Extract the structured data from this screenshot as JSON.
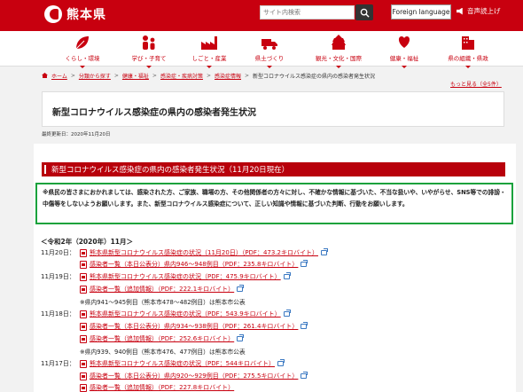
{
  "header": {
    "logo_text": "熊本県",
    "search_placeholder": "サイト内検索",
    "language_button": "Foreign language",
    "voice_button": "音声読上げ"
  },
  "nav": {
    "items": [
      {
        "label": "くらし・環境",
        "icon": "leaf-icon"
      },
      {
        "label": "学び・子育て",
        "icon": "family-icon"
      },
      {
        "label": "しごと・産業",
        "icon": "factory-icon"
      },
      {
        "label": "県土づくり",
        "icon": "truck-icon"
      },
      {
        "label": "観光・文化・国際",
        "icon": "castle-icon"
      },
      {
        "label": "健康・福祉",
        "icon": "heart-hands-icon"
      },
      {
        "label": "県の組織・県政",
        "icon": "building-icon"
      }
    ]
  },
  "breadcrumb": {
    "home": "ホーム",
    "items": [
      "分類から探す",
      "健康・福祉",
      "感染症・疾病対策",
      "感染症情報"
    ],
    "current": "新型コロナウイルス感染症の県内の感染者発生状況"
  },
  "more_link": "もっと見る（全5件）",
  "page_title": "新型コロナウイルス感染症の県内の感染者発生状況",
  "updated": "最終更新日：2020年11月20日",
  "section_header": "新型コロナウイルス感染症の県内の感染者発生状況（11月20日現在）",
  "notice": "※県民の皆さまにおかれましては、感染された方、ご家族、職場の方、その他関係者の方々に対し、不確かな情報に基づいた、不当な扱いや、いやがらせ、SNS等での誹謗・中傷等をしないようお願いします。また、新型コロナウイルス感染症について、正しい知識や情報に基づいた判断、行動をお願いします。",
  "period": "＜令和2年（2020年）11月＞",
  "entries": [
    {
      "date": "11月20日：",
      "link": "熊本県新型コロナウイルス感染症の状況（11月20日）（PDF：473.2キロバイト）"
    },
    {
      "date": "",
      "link": "感染者一覧（本日公表分）県内946～948例目（PDF：235.8キロバイト）"
    },
    {
      "date": "11月19日：",
      "link": "熊本県新型コロナウイルス感染症の状況（PDF：475.9キロバイト）"
    },
    {
      "date": "",
      "link": "感染者一覧（追加情報）（PDF：222.1キロバイト）"
    },
    {
      "note": "※県内941～945例目（熊本市478～482例目）は熊本市公表"
    },
    {
      "date": "11月18日：",
      "link": "熊本県新型コロナウイルス感染症の状況（PDF：543.9キロバイト）"
    },
    {
      "date": "",
      "link": "感染者一覧（本日公表分）県内934～938例目（PDF：261.4キロバイト）"
    },
    {
      "date": "",
      "link": "感染者一覧（追加情報）（PDF：252.6キロバイト）"
    },
    {
      "note": "※県内939、940例目（熊本市476、477例目）は熊本市公表"
    },
    {
      "date": "11月17日：",
      "link": "熊本県新型コロナウイルス感染症の状況（PDF：544キロバイト）"
    },
    {
      "date": "",
      "link": "感染者一覧（本日公表分）県内920～929例目（PDF：275.5キロバイト）"
    },
    {
      "date": "",
      "link": "感染者一覧（追加情報）（PDF：227.8キロバイト）"
    }
  ],
  "colors": {
    "brand_red": "#c8000f",
    "notice_border": "#1aa23c"
  }
}
